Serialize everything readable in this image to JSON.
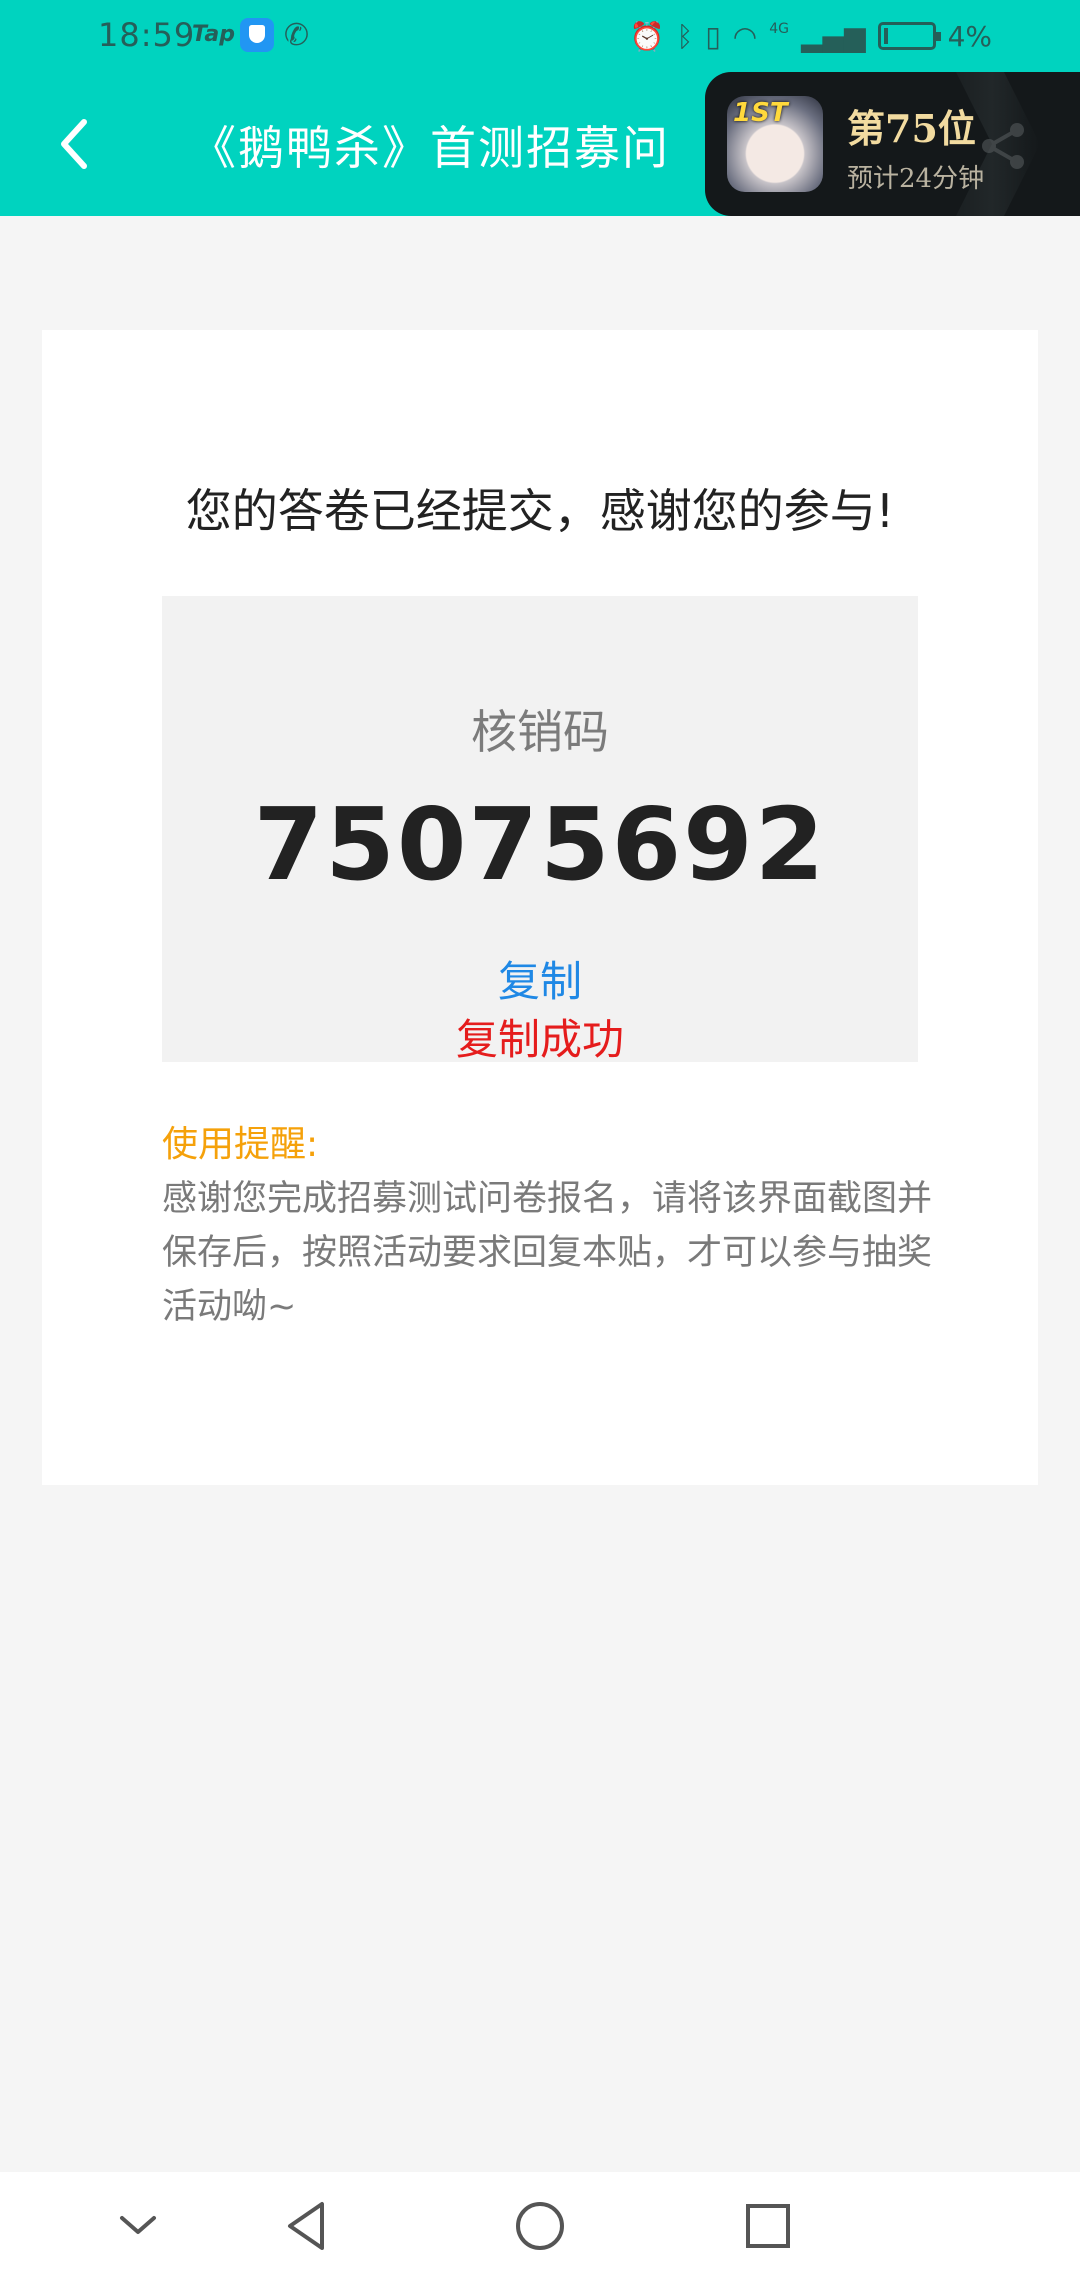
{
  "status_bar": {
    "time": "18:59",
    "tap_label": "Tap",
    "network": "4G",
    "battery": "4%"
  },
  "header": {
    "title": "《鹅鸭杀》首测招募问"
  },
  "overlay": {
    "badge": "1ST",
    "rank": "第75位",
    "eta": "预计24分钟"
  },
  "card": {
    "heading": "您的答卷已经提交，感谢您的参与!",
    "code_label": "核销码",
    "code_value": "75075692",
    "copy_label": "复制",
    "copy_success": "复制成功",
    "reminder_title": "使用提醒:",
    "reminder_text": "感谢您完成招募测试问卷报名，请将该界面截图并保存后，按照活动要求回复本贴，才可以参与抽奖活动呦~"
  },
  "colors": {
    "accent": "#00d3bf",
    "link": "#1f88e5",
    "success": "#e51c1c",
    "warning": "#f5a10a"
  },
  "icons": [
    "back-icon",
    "share-icon",
    "nav-hide-icon",
    "nav-back-icon",
    "nav-home-icon",
    "nav-recents-icon"
  ]
}
